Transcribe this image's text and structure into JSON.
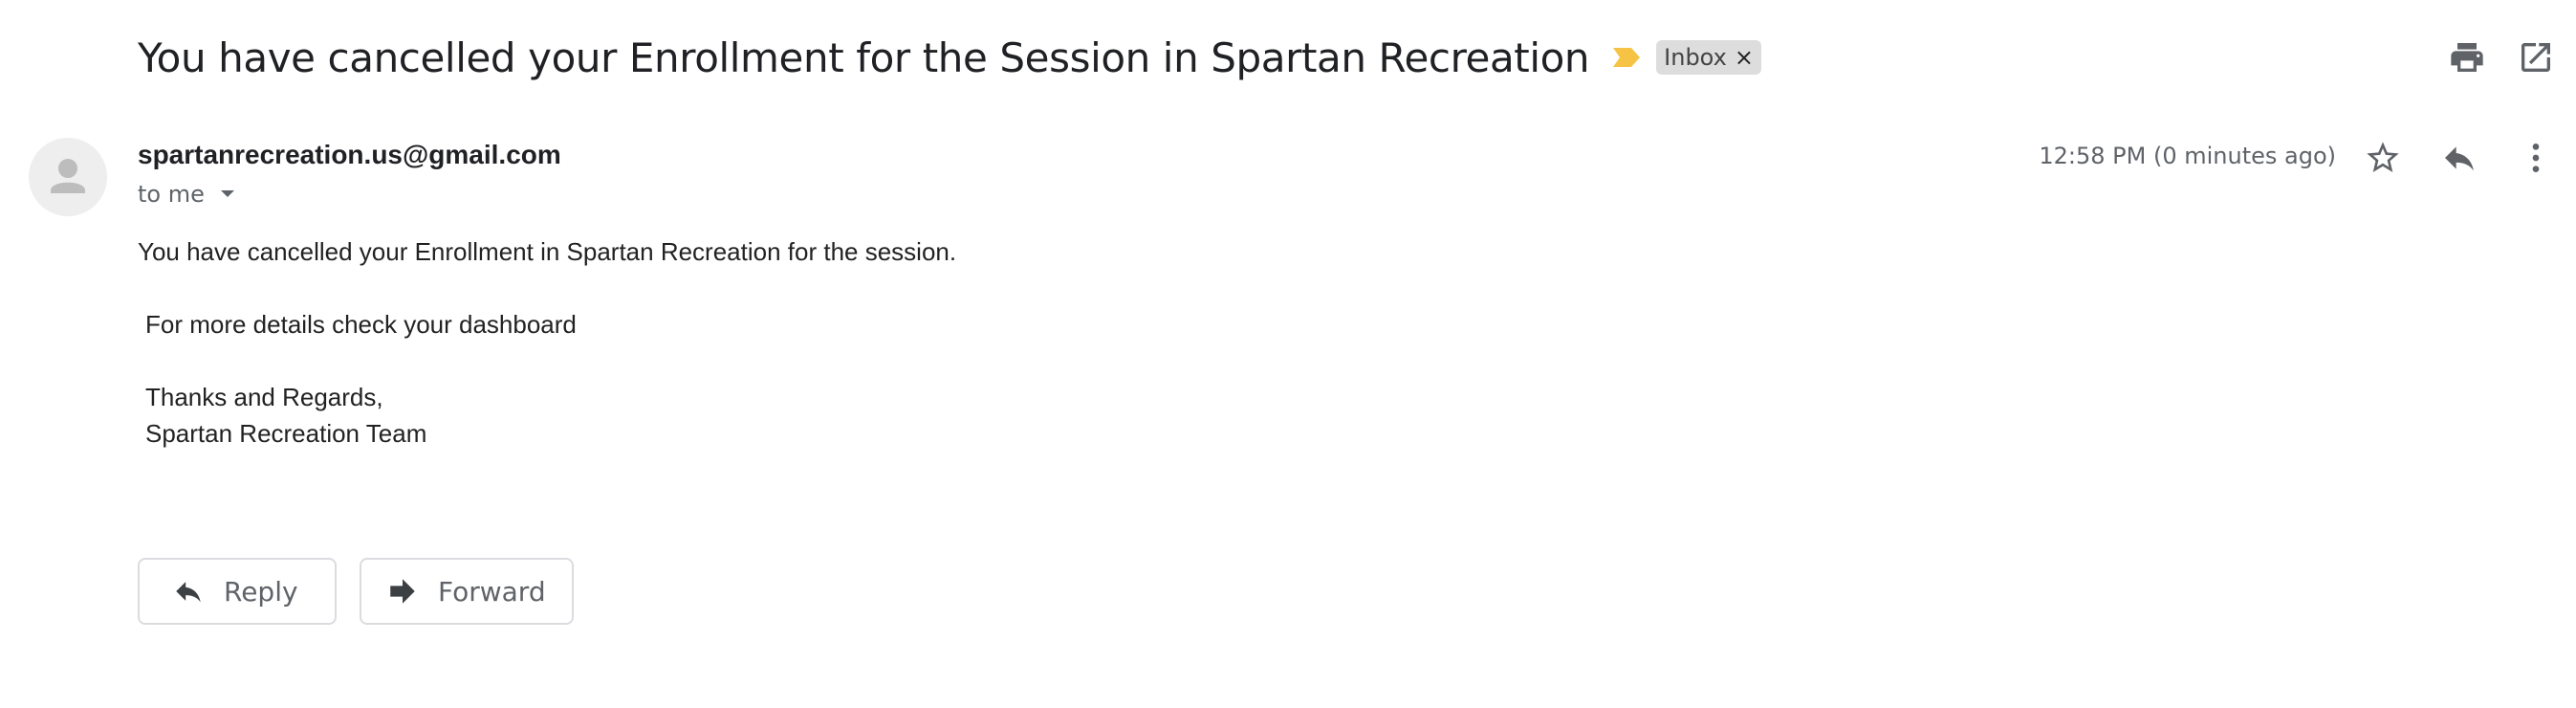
{
  "email": {
    "subject": "You have cancelled your Enrollment for the Session in Spartan Recreation",
    "label": "Inbox",
    "label_close": "×",
    "sender": "spartanrecreation.us@gmail.com",
    "recipient_line": "to me",
    "timestamp": "12:58 PM (0 minutes ago)",
    "body": {
      "line1": "You have cancelled your Enrollment in Spartan Recreation for the session.",
      "line2": "For more details check your dashboard",
      "line3": "Thanks and Regards,",
      "line4": "Spartan Recreation Team"
    }
  },
  "actions": {
    "reply_label": "Reply",
    "forward_label": "Forward"
  },
  "icons": {
    "important": "important-marker-icon",
    "print": "print-icon",
    "open_new_window": "open-in-new-window-icon",
    "star": "star-icon",
    "reply": "reply-icon",
    "more": "more-vert-icon",
    "avatar": "person-icon",
    "dropdown": "chevron-down-icon",
    "forward": "forward-icon"
  },
  "colors": {
    "important_marker": "#f6c344",
    "label_chip_bg": "#dddddd",
    "icon_gray": "#5f6368",
    "text_dark": "#202124"
  }
}
